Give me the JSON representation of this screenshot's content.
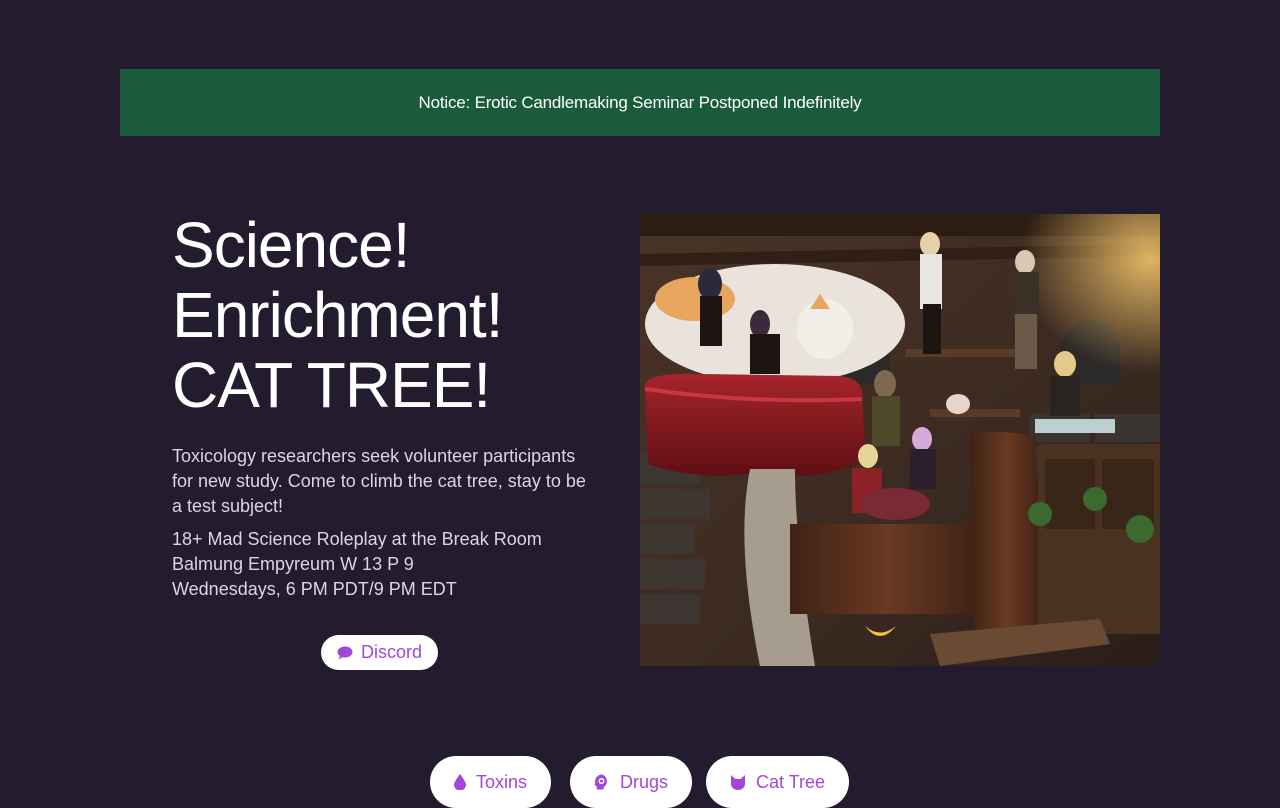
{
  "notice": {
    "text": "Notice: Erotic Candlemaking Seminar Postponed Indefinitely"
  },
  "hero": {
    "headline": [
      "Science!",
      "Enrichment!",
      "CAT TREE!"
    ],
    "description": "Toxicology researchers seek volunteer participants for new study. Come to climb the cat tree, stay to be a test subject!",
    "details": [
      "18+ Mad Science Roleplay at the Break Room",
      "Balmung Empyreum W 13 P 9",
      "Wednesdays, 6 PM PDT/9 PM EDT"
    ],
    "discord_button": {
      "label": "Discord",
      "icon": "chat-bubble-icon"
    }
  },
  "nav_pills": [
    {
      "label": "Toxins",
      "icon": "droplet-icon"
    },
    {
      "label": "Drugs",
      "icon": "head-brain-icon"
    },
    {
      "label": "Cat Tree",
      "icon": "cat-icon"
    }
  ],
  "colors": {
    "background": "#221c2e",
    "notice_bg": "#195b3a",
    "accent": "#a048d8",
    "pill_bg": "#ffffff"
  }
}
